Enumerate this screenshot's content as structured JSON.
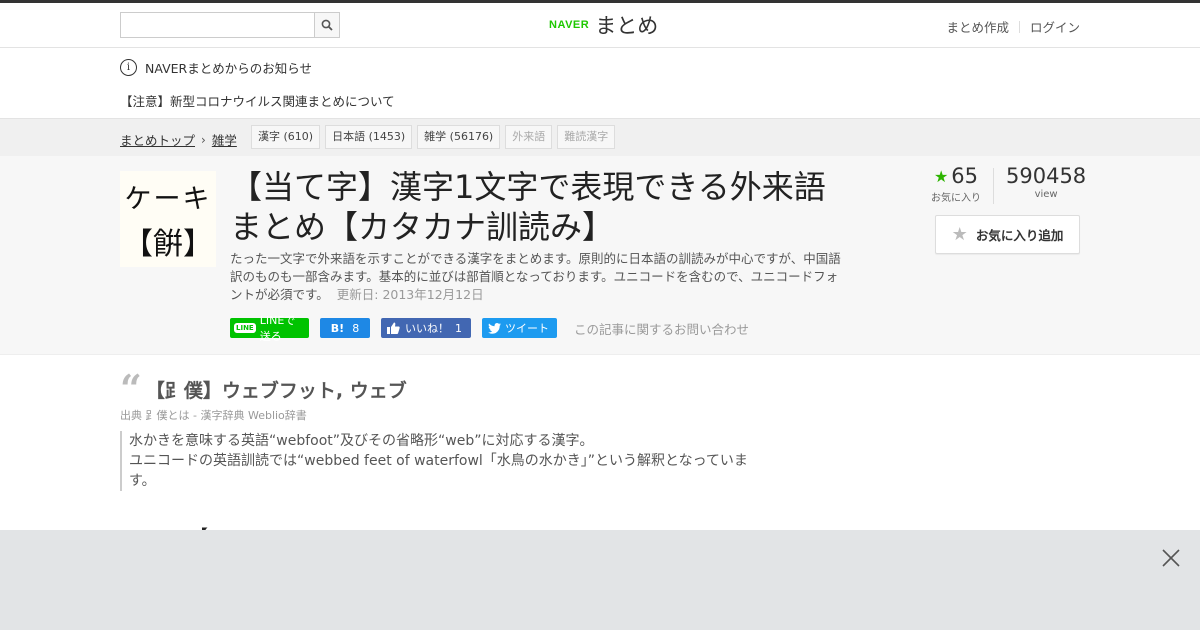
{
  "header": {
    "search_placeholder": "",
    "logo_brand": "NAVER",
    "logo_text": "まとめ",
    "create_link": "まとめ作成",
    "login_link": "ログイン"
  },
  "notices": {
    "icon_glyph": "i",
    "title": "NAVERまとめからのお知らせ",
    "link": "【注意】新型コロナウイルス関連まとめについて"
  },
  "breadcrumb": {
    "items": [
      "まとめトップ",
      "雑学"
    ],
    "separator": "›"
  },
  "tags": [
    {
      "label": "漢字 (610)",
      "dim": false
    },
    {
      "label": "日本語 (1453)",
      "dim": false
    },
    {
      "label": "雑学 (56176)",
      "dim": false
    },
    {
      "label": "外来語",
      "dim": true
    },
    {
      "label": "難読漢字",
      "dim": true
    }
  ],
  "article": {
    "thumb_line1": "ケーキ",
    "thumb_line2": "【餠】",
    "title": "【当て字】漢字1文字で表現できる外来語まとめ【カタカナ訓読み】",
    "description": "たった一文字で外来語を示すことができる漢字をまとめます。原則的に日本語の訓読みが中心ですが、中国語訳のものも一部含みます。基本的に並びは部首順となっております。ユニコードを含むので、ユニコードフォントが必須です。",
    "updated": "更新日: 2013年12月12日"
  },
  "stats": {
    "favorites": "65",
    "favorites_label": "お気に入り",
    "views": "590458",
    "views_label": "view",
    "fav_button": "お気に入り追加"
  },
  "share": {
    "line_badge": "LINE",
    "line": "LINEで送る",
    "hatena_icon": "B!",
    "hatena_count": "8",
    "fb_like": "いいね！",
    "fb_count": "1",
    "tweet": "ツイート",
    "contact": "この記事に関するお問い合わせ"
  },
  "item": {
    "title": "【𧾷僕】ウェブフット, ウェブ",
    "source_prefix": "出典",
    "source": "𧾷僕とは - 漢字辞典 Weblio辞書",
    "body_line1": "水かきを意味する英語“webfoot”及びその省略形“web”に対応する漢字。",
    "body_line2": "ユニコードの英語訓読では“webbed feet of waterfowl「水鳥の水かき」”という解釈となっています。"
  },
  "next_item_peek": "【",
  "colors": {
    "naver_green": "#1ec800",
    "star_green": "#2db400",
    "line_green": "#00c300",
    "hatena_blue": "#1e88e5",
    "facebook_blue": "#4267b2",
    "twitter_blue": "#1d9bf0"
  },
  "icons": {
    "search_button": "search-icon",
    "close_overlay": "close-icon",
    "info": "info-icon"
  }
}
